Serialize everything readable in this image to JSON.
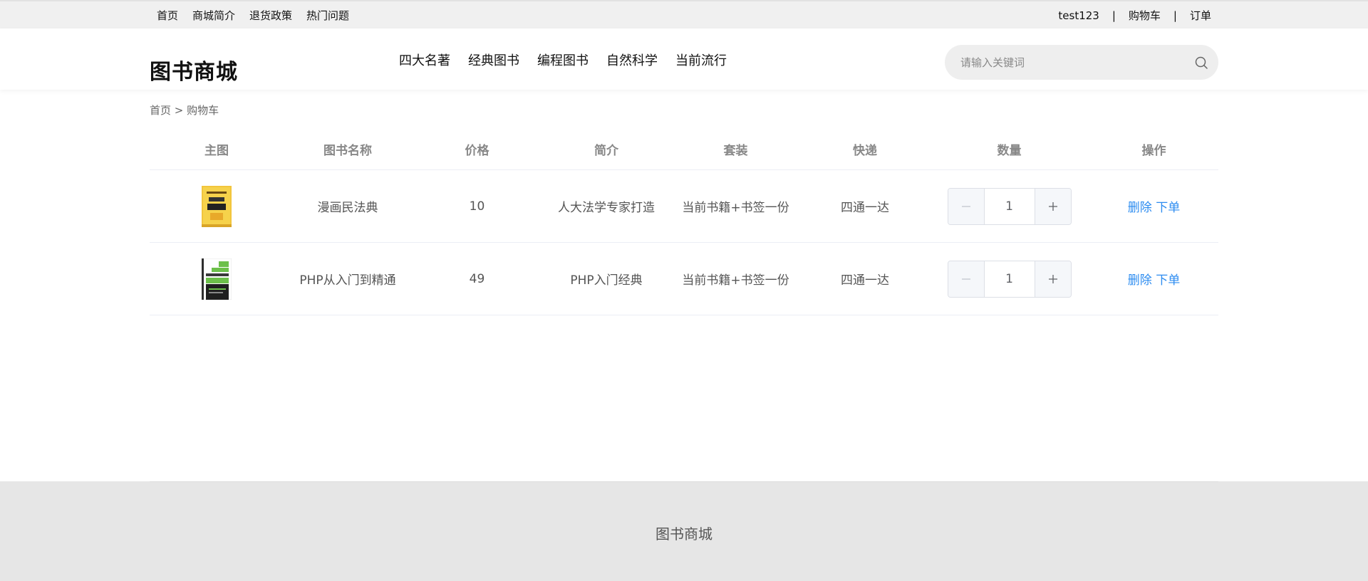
{
  "topbar": {
    "left_links": [
      "首页",
      "商城简介",
      "退货政策",
      "热门问题"
    ],
    "username": "test123",
    "separator": "|",
    "cart_link": "购物车",
    "orders_link": "订单"
  },
  "header": {
    "logo": "图书商城",
    "nav": [
      "四大名著",
      "经典图书",
      "编程图书",
      "自然科学",
      "当前流行"
    ],
    "search": {
      "placeholder": "请输入关键词",
      "value": "",
      "icon": "search-icon"
    }
  },
  "breadcrumb": {
    "home": "首页",
    "separator": ">",
    "current": "购物车"
  },
  "cart": {
    "columns": [
      "主图",
      "图书名称",
      "价格",
      "简介",
      "套装",
      "快递",
      "数量",
      "操作"
    ],
    "rows": [
      {
        "image_icon": "book-cover-yellow",
        "name": "漫画民法典",
        "price": "10",
        "intro": "人大法学专家打造",
        "set": "当前书籍+书签一份",
        "express": "四通一达",
        "quantity": "1",
        "delete_label": "删除",
        "order_label": "下单"
      },
      {
        "image_icon": "book-cover-php",
        "name": "PHP从入门到精通",
        "price": "49",
        "intro": "PHP入门经典",
        "set": "当前书籍+书签一份",
        "express": "四通一达",
        "quantity": "1",
        "delete_label": "删除",
        "order_label": "下单"
      }
    ]
  },
  "footer": {
    "brand": "图书商城"
  },
  "colors": {
    "link_blue": "#2d8cf0",
    "topbar_bg": "#f0f0f0",
    "footer_bg": "#e6e6e6"
  }
}
